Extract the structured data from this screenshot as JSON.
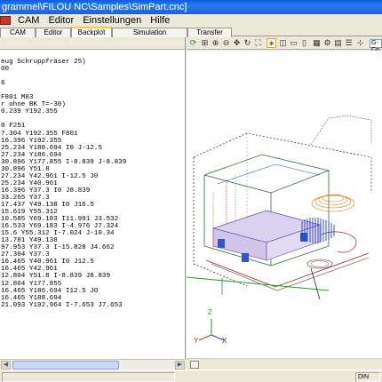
{
  "window": {
    "title": "grammel\\FILOU NC\\Samples\\SimPart.cnc]"
  },
  "menu": {
    "items": [
      "CAM",
      "Editor",
      "Einstellungen",
      "Hilfe"
    ]
  },
  "tabs": [
    {
      "label": "CAM",
      "active": false
    },
    {
      "label": "Editor",
      "active": false
    },
    {
      "label": "Backplot",
      "active": true
    },
    {
      "label": "Simulation",
      "active": false
    },
    {
      "label": "Transfer",
      "active": false
    }
  ],
  "toolbar": {
    "view_combo": "G-Co"
  },
  "editor": {
    "lines": [
      "",
      "eug Schruppfräser 25)",
      "00",
      "",
      "6",
      "",
      "F801 M03",
      "r ohne BK T=-30)",
      "0.239 Y192.355",
      "",
      "0 F251",
      "7.304 Y192.355 F801",
      "16.396 Y192.355",
      "25.234 Y188.694 I0 J-12.5",
      "27.234 Y186.694",
      "30.896 Y177.855 I-8.839 J-8.839",
      "30.896 Y51.8",
      "27.234 Y42.961 I-12.5 J0",
      "25.234 Y40.961",
      "16.396 Y37.3 I0 J8.839",
      "33.265 Y37.3",
      "17.437 Y49.138 I0 J16.5",
      "15.619 Y55.312",
      "10.585 Y69.183 I11.991 J3.532",
      "16.533 Y69.183 I-4.976 J7.324",
      "15.6 Y55.312 I-7.024 J-10.34",
      "13.781 Y49.138",
      "97.953 Y37.3 I-15.828 J4.662",
      "27.304 Y37.3",
      "16.465 Y40.961 I0 J12.5",
      "16.465 Y42.961",
      "12.804 Y51.8 I-8.839 J8.839",
      "12.804 Y177.855",
      "16.465 Y186.694 I12.5 J0",
      "16.465 Y188.694",
      "21.093 Y192.964 I-7.653 J7.653"
    ]
  },
  "status": {
    "right_text": "DIN"
  },
  "viewport": {
    "axis_z": "Z",
    "axis_y": "Y",
    "axis_x": "X"
  }
}
